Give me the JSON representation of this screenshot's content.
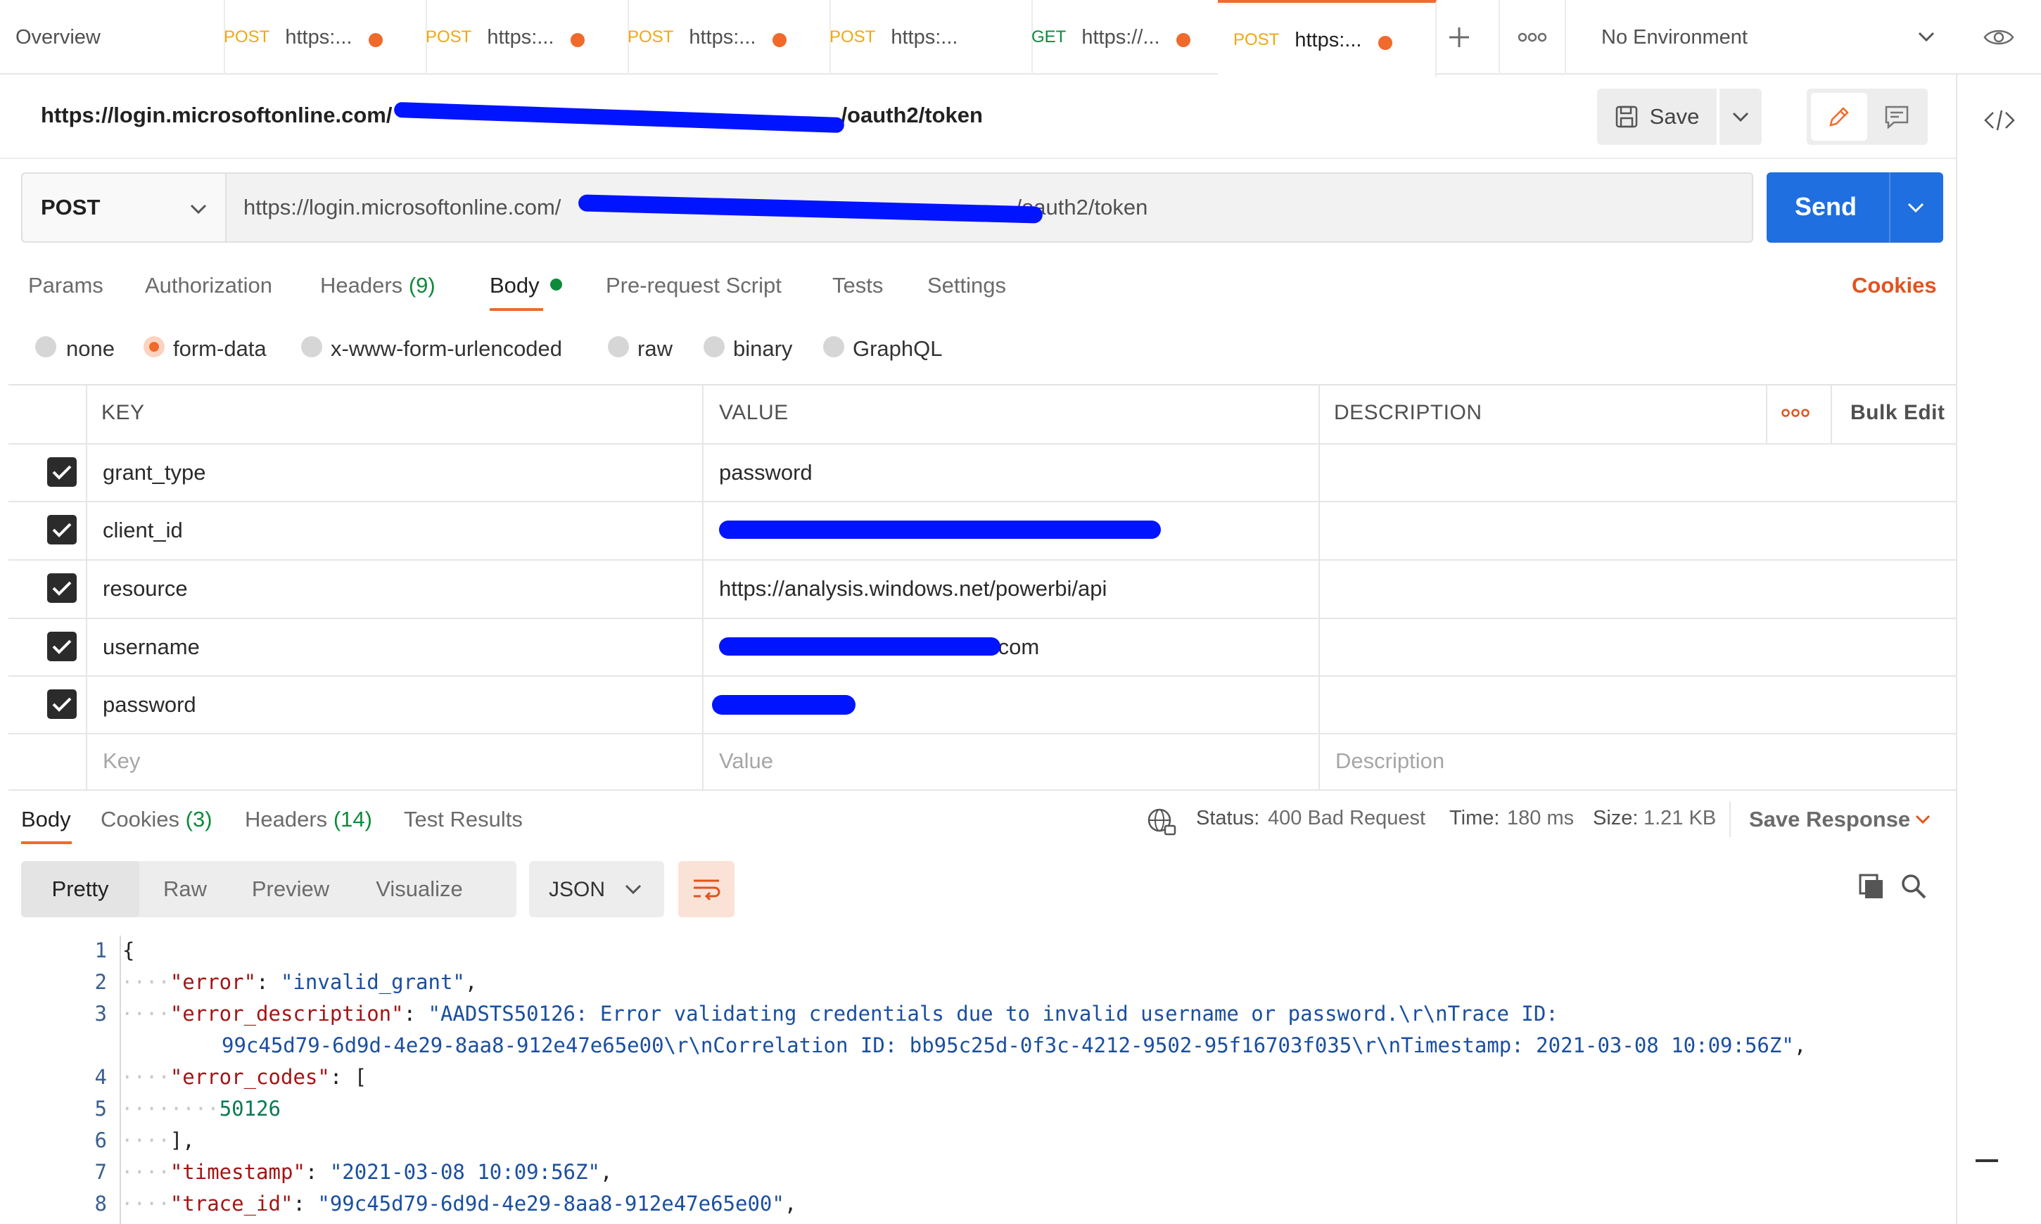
{
  "tabs": {
    "overview": "Overview",
    "items": [
      {
        "method": "POST",
        "label": "https:..."
      },
      {
        "method": "POST",
        "label": "https:..."
      },
      {
        "method": "POST",
        "label": "https:..."
      },
      {
        "method": "POST",
        "label": "https:..."
      },
      {
        "method": "GET",
        "label": "https://..."
      },
      {
        "method": "POST",
        "label": "https:..."
      }
    ],
    "environment": "No Environment",
    "colors": {
      "post": "#f0a90f",
      "get": "#0e8a3c",
      "accent": "#ef6a2b"
    }
  },
  "request": {
    "title_prefix": "https://login.microsoftonline.com/",
    "title_suffix": "/oauth2/token",
    "save_label": "Save",
    "method": "POST",
    "url_prefix": "https://login.microsoftonline.com/",
    "url_suffix": "/oauth2/token",
    "send_label": "Send"
  },
  "request_tabs": {
    "params": "Params",
    "authorization": "Authorization",
    "headers": "Headers",
    "headers_count": "(9)",
    "body": "Body",
    "pre_request": "Pre-request Script",
    "tests": "Tests",
    "settings": "Settings",
    "cookies": "Cookies"
  },
  "body_types": [
    "none",
    "form-data",
    "x-www-form-urlencoded",
    "raw",
    "binary",
    "GraphQL"
  ],
  "table": {
    "headers": {
      "key": "KEY",
      "value": "VALUE",
      "description": "DESCRIPTION",
      "bulk_edit": "Bulk Edit"
    },
    "rows": [
      {
        "key": "grant_type",
        "value": "password"
      },
      {
        "key": "client_id",
        "value": ""
      },
      {
        "key": "resource",
        "value": "https://analysis.windows.net/powerbi/api"
      },
      {
        "key": "username",
        "value": ".com"
      },
      {
        "key": "password",
        "value": ""
      }
    ],
    "placeholders": {
      "key": "Key",
      "value": "Value",
      "description": "Description"
    }
  },
  "response": {
    "tabs": {
      "body": "Body",
      "cookies": "Cookies",
      "cookies_count": "(3)",
      "headers": "Headers",
      "headers_count": "(14)",
      "test_results": "Test Results"
    },
    "status_label": "Status:",
    "status_value": "400 Bad Request",
    "time_label": "Time:",
    "time_value": "180 ms",
    "size_label": "Size:",
    "size_value": "1.21 KB",
    "save_response": "Save Response",
    "views": [
      "Pretty",
      "Raw",
      "Preview",
      "Visualize"
    ],
    "format": "JSON",
    "code": {
      "line_numbers": [
        "1",
        "2",
        "3",
        "4",
        "5",
        "6",
        "7",
        "8"
      ],
      "open_brace": "{",
      "error_key": "\"error\"",
      "error_val": "\"invalid_grant\"",
      "desc_key": "\"error_description\"",
      "desc_val_1": "\"AADSTS50126: Error validating credentials due to invalid username or password.\\r\\nTrace ID:",
      "desc_val_2": "99c45d79-6d9d-4e29-8aa8-912e47e65e00\\r\\nCorrelation ID: bb95c25d-0f3c-4212-9502-95f16703f035\\r\\nTimestamp: 2021-03-08 10:09:56Z\"",
      "codes_key": "\"error_codes\"",
      "codes_val": "50126",
      "close_bracket": "],",
      "ts_key": "\"timestamp\"",
      "ts_val": "\"2021-03-08 10:09:56Z\"",
      "trace_key": "\"trace_id\"",
      "trace_val": "\"99c45d79-6d9d-4e29-8aa8-912e47e65e00\""
    }
  }
}
